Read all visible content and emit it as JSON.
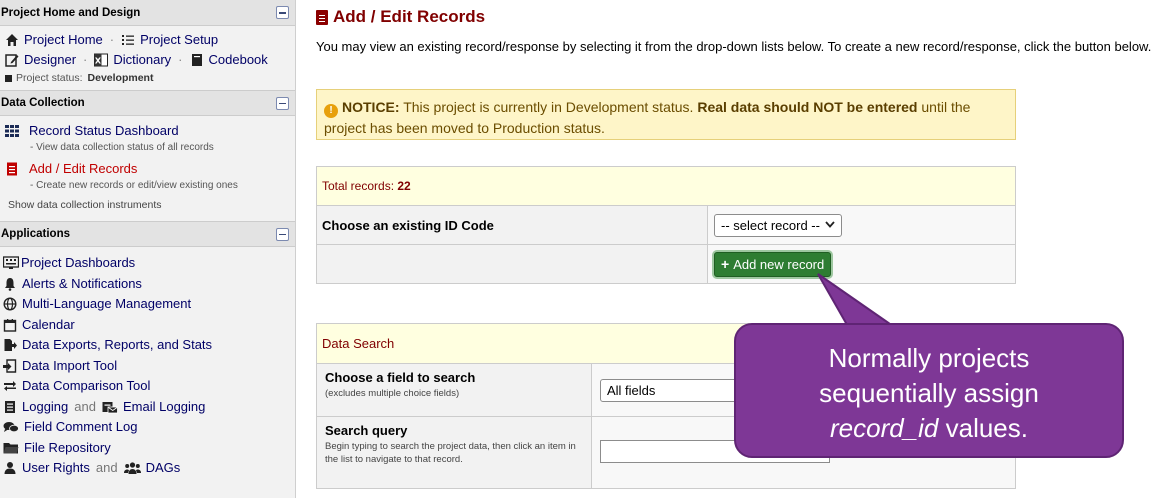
{
  "sidebar": {
    "project_home": {
      "title": "Project Home and Design",
      "items": [
        {
          "label": "Project Home",
          "icon": "home-icon"
        },
        {
          "label": "Project Setup",
          "icon": "list-icon"
        },
        {
          "label": "Designer",
          "icon": "edit-icon"
        },
        {
          "label": "Dictionary",
          "icon": "excel-icon"
        },
        {
          "label": "Codebook",
          "icon": "book-icon"
        }
      ],
      "status_label": "Project status:",
      "status_value": "Development"
    },
    "data_collection": {
      "title": "Data Collection",
      "items": [
        {
          "label": "Record Status Dashboard",
          "desc": "- View data collection status of all records",
          "icon": "grid-icon"
        },
        {
          "label": "Add / Edit Records",
          "desc": "- Create new records or edit/view existing ones",
          "icon": "form-icon"
        }
      ],
      "show_instruments": "Show data collection instruments"
    },
    "applications": {
      "title": "Applications",
      "items": [
        {
          "label": "Project Dashboards",
          "icon": "dashboard-icon"
        },
        {
          "label": "Alerts & Notifications",
          "icon": "bell-icon"
        },
        {
          "label": "Multi-Language Management",
          "icon": "globe-icon"
        },
        {
          "label": "Calendar",
          "icon": "calendar-icon"
        },
        {
          "label": "Data Exports, Reports, and Stats",
          "icon": "export-icon"
        },
        {
          "label": "Data Import Tool",
          "icon": "import-icon"
        },
        {
          "label": "Data Comparison Tool",
          "icon": "compare-icon"
        },
        {
          "label": "Logging",
          "icon": "logging-icon"
        },
        {
          "label": "Email Logging",
          "icon": "email-logging-icon"
        },
        {
          "label": "Field Comment Log",
          "icon": "comments-icon"
        },
        {
          "label": "File Repository",
          "icon": "folder-icon"
        },
        {
          "label": "User Rights",
          "icon": "user-icon"
        },
        {
          "label": "DAGs",
          "icon": "users-icon"
        }
      ],
      "and": "and"
    }
  },
  "main": {
    "title": "Add / Edit Records",
    "intro": "You may view an existing record/response by selecting it from the drop-down lists below. To create a new record/response, click the button below.",
    "notice": {
      "label": "NOTICE:",
      "text1": " This project is currently in Development status. ",
      "bold": "Real data should NOT be entered",
      "text2": " until the project has been moved to Production status."
    },
    "total_label": "Total records:",
    "total_value": "22",
    "choose_label": "Choose an existing ID Code",
    "select_placeholder": "-- select record --",
    "add_button": "Add new record",
    "search": {
      "title": "Data Search",
      "field_label": "Choose a field to search",
      "field_hint": "(excludes multiple choice fields)",
      "field_value": "All fields",
      "query_label": "Search query",
      "query_hint": "Begin typing to search the project data, then click an item in the list to navigate to that record."
    }
  },
  "callout": {
    "line1": "Normally projects",
    "line2": "sequentially assign",
    "italic": "record_id",
    "line3_rest": " values.",
    "color": "#7e3796"
  }
}
